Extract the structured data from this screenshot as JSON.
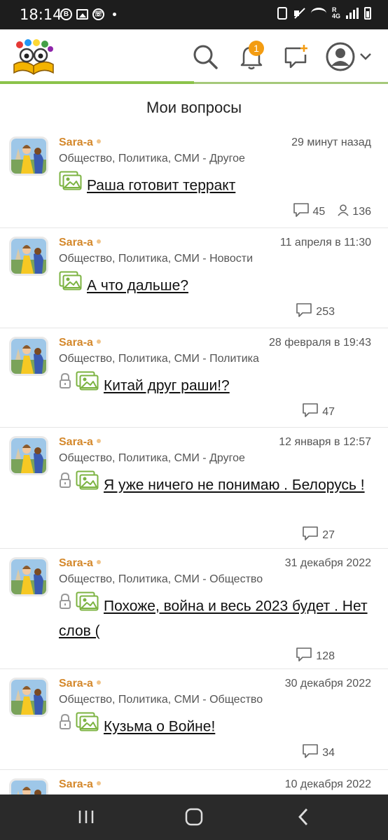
{
  "status_bar": {
    "time": "18:14",
    "network": "4G",
    "network_top": "R"
  },
  "header": {
    "notification_count": "1",
    "icons": [
      "logo",
      "search-icon",
      "bell-icon",
      "add-question-icon",
      "user-icon",
      "chevron-down-icon"
    ],
    "accent_color": "#8bc34a",
    "badge_color": "#f39c12"
  },
  "page": {
    "title": "Мои вопросы"
  },
  "questions": [
    {
      "author": "Sara-a",
      "date": "29 минут назад",
      "category": "Общество, Политика, СМИ - Другое",
      "title": "Раша готовит терракт",
      "locked": false,
      "answers": "45",
      "views": "136"
    },
    {
      "author": "Sara-a",
      "date": "11 апреля в 11:30",
      "category": "Общество, Политика, СМИ - Новости",
      "title": "А что дальше?",
      "locked": false,
      "answers": "253",
      "views": ""
    },
    {
      "author": "Sara-a",
      "date": "28 февраля в 19:43",
      "category": "Общество, Политика, СМИ - Политика",
      "title": "Китай друг раши!?",
      "locked": true,
      "answers": "47",
      "views": ""
    },
    {
      "author": "Sara-a",
      "date": "12 января в 12:57",
      "category": "Общество, Политика, СМИ - Другое",
      "title": "Я уже ничего не понимаю . Белорусь !",
      "locked": true,
      "answers": "27",
      "views": ""
    },
    {
      "author": "Sara-a",
      "date": "31 декабря 2022",
      "category": "Общество, Политика, СМИ - Общество",
      "title": "Похоже, война и весь 2023 будет . Нет слов (",
      "locked": true,
      "answers": "128",
      "views": ""
    },
    {
      "author": "Sara-a",
      "date": "30 декабря 2022",
      "category": "Общество, Политика, СМИ - Общество",
      "title": "Кузьма о Войне!",
      "locked": true,
      "answers": "34",
      "views": ""
    },
    {
      "author": "Sara-a",
      "date": "10 декабря 2022",
      "category": "",
      "title": "",
      "locked": false,
      "answers": "",
      "views": ""
    }
  ],
  "nav": {
    "icons": [
      "recent-apps-icon",
      "home-icon",
      "back-icon"
    ]
  }
}
